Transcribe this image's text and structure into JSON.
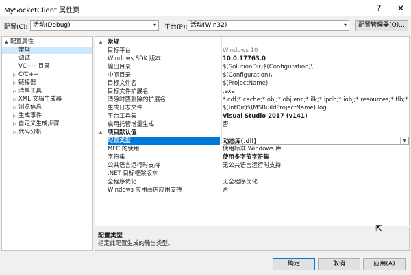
{
  "window": {
    "title": "MySocketClient 属性页",
    "help_glyph": "?",
    "close_glyph": "✕"
  },
  "toolbar": {
    "config_label": "配置(C):",
    "config_value": "活动(Debug)",
    "platform_label": "平台(P):",
    "platform_value": "活动(Win32)",
    "config_manager_label": "配置管理器(O)..."
  },
  "tree": {
    "items": [
      {
        "label": "配置属性",
        "toggle": "▲",
        "indent": 0,
        "selected": false
      },
      {
        "label": "常规",
        "toggle": "",
        "indent": 1,
        "selected": true
      },
      {
        "label": "调试",
        "toggle": "",
        "indent": 1,
        "selected": false
      },
      {
        "label": "VC++ 目录",
        "toggle": "",
        "indent": 1,
        "selected": false
      },
      {
        "label": "C/C++",
        "toggle": "▷",
        "indent": 1,
        "selected": false
      },
      {
        "label": "链接器",
        "toggle": "▷",
        "indent": 1,
        "selected": false
      },
      {
        "label": "清单工具",
        "toggle": "▷",
        "indent": 1,
        "selected": false
      },
      {
        "label": "XML 文档生成器",
        "toggle": "▷",
        "indent": 1,
        "selected": false
      },
      {
        "label": "浏览信息",
        "toggle": "▷",
        "indent": 1,
        "selected": false
      },
      {
        "label": "生成事件",
        "toggle": "▷",
        "indent": 1,
        "selected": false
      },
      {
        "label": "自定义生成步骤",
        "toggle": "▷",
        "indent": 1,
        "selected": false
      },
      {
        "label": "代码分析",
        "toggle": "▷",
        "indent": 1,
        "selected": false
      }
    ]
  },
  "grid": {
    "sections": [
      {
        "title": "常规",
        "toggle": "▲",
        "rows": [
          {
            "name": "目标平台",
            "value": "Windows 10",
            "grayed": true,
            "bold": false
          },
          {
            "name": "Windows SDK 版本",
            "value": "10.0.17763.0",
            "grayed": false,
            "bold": true
          },
          {
            "name": "输出目录",
            "value": "$(SolutionDir)$(Configuration)\\",
            "grayed": false,
            "bold": false
          },
          {
            "name": "中间目录",
            "value": "$(Configuration)\\",
            "grayed": false,
            "bold": false
          },
          {
            "name": "目标文件名",
            "value": "$(ProjectName)",
            "grayed": false,
            "bold": false
          },
          {
            "name": "目标文件扩展名",
            "value": ".exe",
            "grayed": false,
            "bold": false
          },
          {
            "name": "清除时要删除的扩展名",
            "value": "*.cdf;*.cache;*.obj;*.obj.enc;*.ilk;*.ipdb;*.iobj;*.resources;*.tlb;*.tli;*",
            "grayed": false,
            "bold": false
          },
          {
            "name": "生成日志文件",
            "value": "$(IntDir)$(MSBuildProjectName).log",
            "grayed": false,
            "bold": false
          },
          {
            "name": "平台工具集",
            "value": "Visual Studio 2017 (v141)",
            "grayed": false,
            "bold": true
          },
          {
            "name": "启用托管增量生成",
            "value": "否",
            "grayed": false,
            "bold": false
          }
        ]
      },
      {
        "title": "项目默认值",
        "toggle": "▲",
        "rows": [
          {
            "name": "配置类型",
            "value": "动态库(.dll)",
            "grayed": false,
            "bold": true,
            "selected": true
          },
          {
            "name": "MFC 的使用",
            "value": "使用标准 Windows 库",
            "grayed": false,
            "bold": false
          },
          {
            "name": "字符集",
            "value": "使用多字节字符集",
            "grayed": false,
            "bold": true
          },
          {
            "name": "公共语言运行时支持",
            "value": "无公共语言运行时支持",
            "grayed": false,
            "bold": false
          },
          {
            "name": ".NET 目标框架版本",
            "value": "",
            "grayed": false,
            "bold": false
          },
          {
            "name": "全程序优化",
            "value": "无全程序优化",
            "grayed": false,
            "bold": false
          },
          {
            "name": "Windows 应用商店应用支持",
            "value": "否",
            "grayed": false,
            "bold": false
          }
        ]
      }
    ]
  },
  "description": {
    "title": "配置类型",
    "text": "指定此配置生成的输出类型。"
  },
  "buttons": {
    "ok": "确定",
    "cancel": "取消",
    "apply": "应用(A)"
  }
}
